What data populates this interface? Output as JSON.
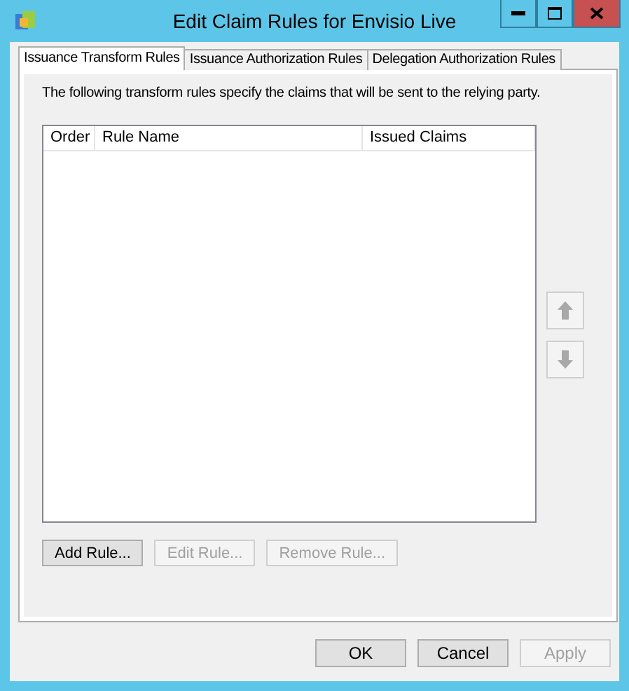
{
  "window": {
    "title": "Edit Claim Rules for Envisio Live"
  },
  "tabs": [
    {
      "label": "Issuance Transform Rules",
      "selected": true
    },
    {
      "label": "Issuance Authorization Rules",
      "selected": false
    },
    {
      "label": "Delegation Authorization Rules",
      "selected": false
    }
  ],
  "description": "The following transform rules specify the claims that will be sent to the relying party.",
  "table": {
    "columns": [
      "Order",
      "Rule Name",
      "Issued Claims"
    ]
  },
  "move_buttons": [
    {
      "kind": "up",
      "disabled": true
    },
    {
      "kind": "down",
      "disabled": true
    }
  ],
  "rule_buttons": [
    {
      "label": "Add Rule...",
      "disabled": false
    },
    {
      "label": "Edit Rule...",
      "disabled": true
    },
    {
      "label": "Remove Rule...",
      "disabled": true
    }
  ],
  "dialog_buttons": [
    {
      "label": "OK",
      "disabled": false
    },
    {
      "label": "Cancel",
      "disabled": false
    },
    {
      "label": "Apply",
      "disabled": true
    }
  ]
}
